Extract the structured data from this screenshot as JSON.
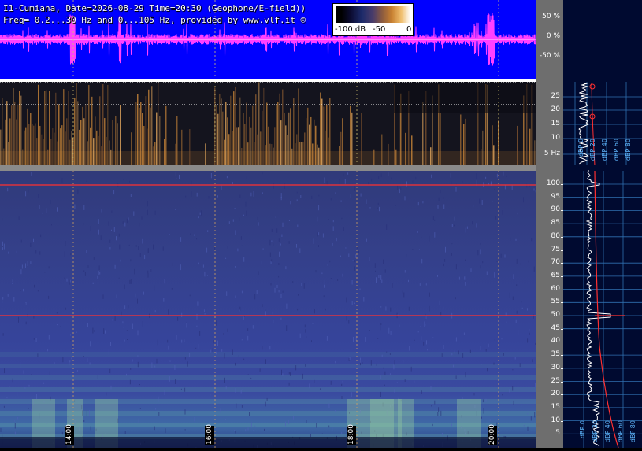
{
  "header": {
    "line1": "I1-Cumiana, Date=2026-08-29 Time=20:30 (Geophone/E-field))",
    "line2": "Freq= 0.2...30 Hz and 0...105 Hz, provided by www.vlf.it ©"
  },
  "colorbar": {
    "labels": [
      "-100 dB",
      "-50",
      "0"
    ]
  },
  "waveform_axis": [
    "50 %",
    "0 %",
    "-50 %"
  ],
  "low_freq_axis": [
    "25",
    "20",
    "15",
    "10",
    "5 Hz"
  ],
  "main_freq_axis": [
    "100",
    "95",
    "90",
    "85",
    "80",
    "75",
    "70",
    "65",
    "60",
    "55",
    "50",
    "45",
    "40",
    "35",
    "30",
    "25",
    "20",
    "15",
    "10",
    "5"
  ],
  "time_labels": [
    "14:00",
    "16:00",
    "18:00",
    "20:00"
  ],
  "profile_upper_labels": [
    "dBP 0",
    "dBP 20",
    "dBP 40",
    "dBP 60",
    "dBP 80"
  ],
  "profile_lower_labels": [
    "dBP 0",
    "dBP 20",
    "dBP 40",
    "dBP 60",
    "dBP 80"
  ],
  "colors": {
    "waveform_bg": "#0000ff",
    "waveform_trace": "#ff40ff",
    "spectrogram_main_bg": "#34408a",
    "profile_bg": "#000a30",
    "profile_grid": "#2f6fb0",
    "axis_bg": "#6e6e6e",
    "marker_line": "#ff3030"
  }
}
